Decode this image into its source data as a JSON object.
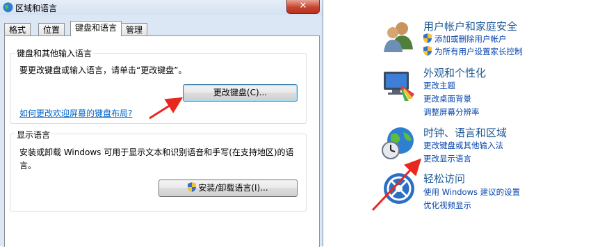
{
  "dialog": {
    "title": "区域和语言",
    "close_label": "✕",
    "tabs": [
      {
        "label": "格式"
      },
      {
        "label": "位置"
      },
      {
        "label": "键盘和语言",
        "active": true
      },
      {
        "label": "管理"
      }
    ],
    "keyboard_group": {
      "title": "键盘和其他输入语言",
      "description": "要更改键盘或输入语言，请单击“更改键盘”。",
      "button": "更改键盘(C)...",
      "link": "如何更改欢迎屏幕的键盘布局?"
    },
    "display_group": {
      "title": "显示语言",
      "description_line1": "安装或卸载 Windows 可用于显示文本和识别语音和手写(在支持地区)的语",
      "description_line2": "言。",
      "button": "安装/卸载语言(I)..."
    }
  },
  "control_panel": {
    "categories": [
      {
        "title": "用户帐户和家庭安全",
        "icon": "users-icon",
        "links": [
          "添加或删除用户帐户",
          "为所有用户设置家长控制"
        ]
      },
      {
        "title": "外观和个性化",
        "icon": "monitor-paint-icon",
        "links": [
          "更改主题",
          "更改桌面背景",
          "调整屏幕分辨率"
        ]
      },
      {
        "title": "时钟、语言和区域",
        "icon": "globe-clock-icon",
        "links": [
          "更改键盘或其他输入法",
          "更改显示语言"
        ]
      },
      {
        "title": "轻松访问",
        "icon": "accessibility-icon",
        "links": [
          "使用 Windows 建议的设置",
          "优化视频显示"
        ]
      }
    ]
  },
  "annotation_color": "#e8281e"
}
